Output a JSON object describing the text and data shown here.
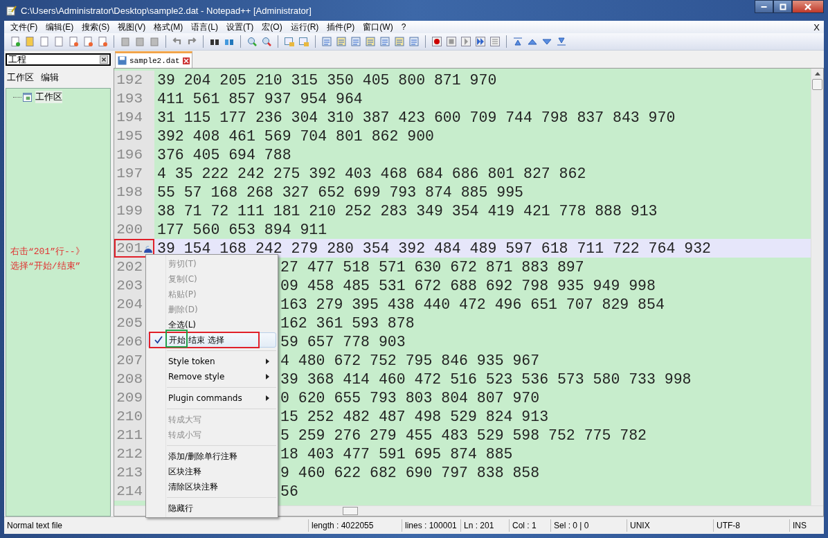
{
  "window": {
    "title": "C:\\Users\\Administrator\\Desktop\\sample2.dat - Notepad++ [Administrator]"
  },
  "menu_bar": [
    "文件(F)",
    "编辑(E)",
    "搜索(S)",
    "视图(V)",
    "格式(M)",
    "语言(L)",
    "设置(T)",
    "宏(O)",
    "运行(R)",
    "插件(P)",
    "窗口(W)",
    "?"
  ],
  "menu_close": "X",
  "project_panel": {
    "title": "工程",
    "tabs": [
      "工作区",
      "编辑"
    ],
    "tree": [
      {
        "label": "工作区"
      }
    ],
    "note": [
      "右击“201”行--》",
      "选择“开始/结束”"
    ]
  },
  "tabs": [
    {
      "label": "sample2.dat",
      "selected": true
    }
  ],
  "editor": {
    "lines": [
      {
        "number": "192",
        "text": "39 204 205 210 315 350 405 800 871 970",
        "kind": "full",
        "current": false,
        "bookmark": false,
        "boxed": false
      },
      {
        "number": "193",
        "text": "411 561 857 937 954 964",
        "kind": "full",
        "current": false,
        "bookmark": false,
        "boxed": false
      },
      {
        "number": "194",
        "text": "31 115 177 236 304 310 387 423 600 709 744 798 837 843 970",
        "kind": "full",
        "current": false,
        "bookmark": false,
        "boxed": false
      },
      {
        "number": "195",
        "text": "392 408 461 569 704 801 862 900",
        "kind": "full",
        "current": false,
        "bookmark": false,
        "boxed": false
      },
      {
        "number": "196",
        "text": "376 405 694 788",
        "kind": "full",
        "current": false,
        "bookmark": false,
        "boxed": false
      },
      {
        "number": "197",
        "text": "4 35 222 242 275 392 403 468 684 686 801 827 862",
        "kind": "full",
        "current": false,
        "bookmark": false,
        "boxed": false
      },
      {
        "number": "198",
        "text": "55 57 168 268 327 652 699 793 874 885 995",
        "kind": "full",
        "current": false,
        "bookmark": false,
        "boxed": false
      },
      {
        "number": "199",
        "text": "38 71 72 111 181 210 252 283 349 354 419 421 778 888 913",
        "kind": "full",
        "current": false,
        "bookmark": false,
        "boxed": false
      },
      {
        "number": "200",
        "text": "177 560 653 894 911",
        "kind": "full",
        "current": false,
        "bookmark": false,
        "boxed": false
      },
      {
        "number": "201",
        "text": "39 154 168 242 279 280 354 392 484 489 597 618 711 722 764 932",
        "kind": "full",
        "current": true,
        "bookmark": true,
        "boxed": true
      },
      {
        "number": "202",
        "text": "27 477 518 571 630 672 871 883 897",
        "kind": "covered",
        "current": false,
        "bookmark": false,
        "boxed": false
      },
      {
        "number": "203",
        "text": "09 458 485 531 672 688 692 798 935 949 998",
        "kind": "covered",
        "current": false,
        "bookmark": false,
        "boxed": false
      },
      {
        "number": "204",
        "text": "163 279 395 438 440 472 496 651 707 829 854",
        "kind": "covered",
        "current": false,
        "bookmark": false,
        "boxed": false
      },
      {
        "number": "205",
        "text": "162 361 593 878",
        "kind": "covered",
        "current": false,
        "bookmark": false,
        "boxed": false
      },
      {
        "number": "206",
        "text": "59 657 778 903",
        "kind": "covered",
        "current": false,
        "bookmark": false,
        "boxed": false
      },
      {
        "number": "207",
        "text": "4 480 672 752 795 846 935 967",
        "kind": "covered",
        "current": false,
        "bookmark": false,
        "boxed": false
      },
      {
        "number": "208",
        "text": "39 368 414 460 472 516 523 536 573 580 733 998",
        "kind": "covered",
        "current": false,
        "bookmark": false,
        "boxed": false
      },
      {
        "number": "209",
        "text": "0 620 655 793 803 804 807 970",
        "kind": "covered",
        "current": false,
        "bookmark": false,
        "boxed": false
      },
      {
        "number": "210",
        "text": "15 252 482 487 498 529 824 913",
        "kind": "covered",
        "current": false,
        "bookmark": false,
        "boxed": false
      },
      {
        "number": "211",
        "text": "5 259 276 279 455 483 529 598 752 775 782",
        "kind": "covered",
        "current": false,
        "bookmark": false,
        "boxed": false
      },
      {
        "number": "212",
        "text": "18 403 477 591 695 874 885",
        "kind": "covered",
        "current": false,
        "bookmark": false,
        "boxed": false
      },
      {
        "number": "213",
        "text": "9 460 622 682 690 797 838 858",
        "kind": "covered",
        "current": false,
        "bookmark": false,
        "boxed": false
      },
      {
        "number": "214",
        "text": "56",
        "kind": "covered",
        "current": false,
        "bookmark": false,
        "boxed": false
      }
    ]
  },
  "context_menu": [
    {
      "kind": "item",
      "label": "剪切(T)",
      "disabled": true,
      "checked": false,
      "selected": false
    },
    {
      "kind": "item",
      "label": "复制(C)",
      "disabled": true,
      "checked": false,
      "selected": false
    },
    {
      "kind": "item",
      "label": "粘贴(P)",
      "disabled": true,
      "checked": false,
      "selected": false
    },
    {
      "kind": "item",
      "label": "删除(D)",
      "disabled": true,
      "checked": false,
      "selected": false
    },
    {
      "kind": "item",
      "label": "全选(L)",
      "disabled": false,
      "checked": false,
      "selected": false
    },
    {
      "kind": "item",
      "label": "开始 结束 选择",
      "disabled": false,
      "checked": true,
      "selected": true
    },
    {
      "kind": "separator"
    },
    {
      "kind": "submenu",
      "label": "Style token",
      "disabled": false,
      "checked": false,
      "selected": false
    },
    {
      "kind": "submenu",
      "label": "Remove style",
      "disabled": false,
      "checked": false,
      "selected": false
    },
    {
      "kind": "separator"
    },
    {
      "kind": "submenu",
      "label": "Plugin commands",
      "disabled": false,
      "checked": false,
      "selected": false
    },
    {
      "kind": "separator"
    },
    {
      "kind": "item",
      "label": "转成大写",
      "disabled": true,
      "checked": false,
      "selected": false
    },
    {
      "kind": "item",
      "label": "转成小写",
      "disabled": true,
      "checked": false,
      "selected": false
    },
    {
      "kind": "separator"
    },
    {
      "kind": "item",
      "label": "添加/删除单行注释",
      "disabled": false,
      "checked": false,
      "selected": false
    },
    {
      "kind": "item",
      "label": "区块注释",
      "disabled": false,
      "checked": false,
      "selected": false
    },
    {
      "kind": "item",
      "label": "清除区块注释",
      "disabled": false,
      "checked": false,
      "selected": false
    },
    {
      "kind": "separator"
    },
    {
      "kind": "item",
      "label": "隐藏行",
      "disabled": false,
      "checked": false,
      "selected": false
    }
  ],
  "status_bar": [
    "Normal text file",
    "length : 4022055",
    "lines : 100001",
    "Ln : 201",
    "Col : 1",
    "Sel : 0 | 0",
    "UNIX",
    "UTF-8",
    "INS"
  ]
}
